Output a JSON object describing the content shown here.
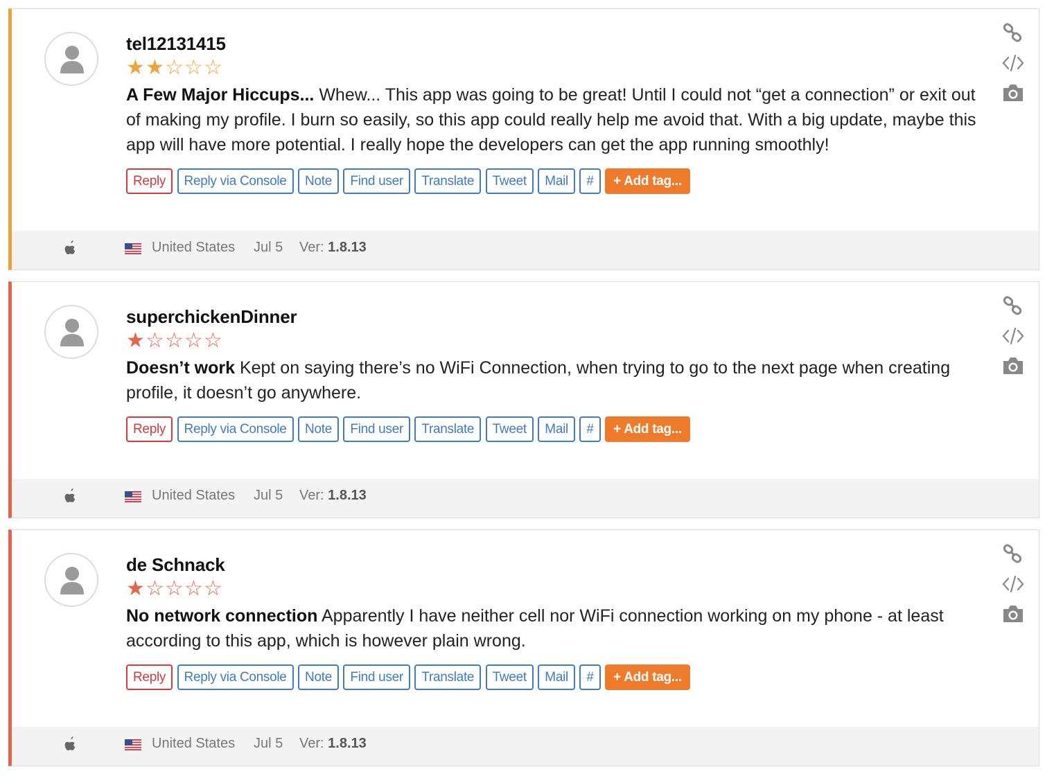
{
  "actions": {
    "reply": "Reply",
    "reply_console": "Reply via Console",
    "note": "Note",
    "find_user": "Find user",
    "translate": "Translate",
    "tweet": "Tweet",
    "mail": "Mail",
    "hash": "#",
    "add_tag": "+ Add tag..."
  },
  "footer_labels": {
    "ver_prefix": "Ver:"
  },
  "side_icons": [
    "link-icon",
    "code-icon",
    "camera-icon"
  ],
  "colors": {
    "orange": "#f0a33a",
    "red": "#e2654b",
    "link_blue": "#3f7bbf",
    "tag_orange": "#ee7b2c"
  },
  "reviews": [
    {
      "username": "tel12131415",
      "rating": 2,
      "stars": "★★☆☆☆",
      "title": "A Few Major Hiccups...",
      "body": "Whew... This app was going to be great! Until I could not “get a connection” or exit out of making my profile. I burn so easily, so this app could really help me avoid that. With a big update, maybe this app will have more potential. I really hope the developers can get the app running smoothly!",
      "platform": "apple-icon",
      "country": "United States",
      "date": "Jul 5",
      "version": "1.8.13"
    },
    {
      "username": "superchickenDinner",
      "rating": 1,
      "stars": "★☆☆☆☆",
      "title": "Doesn’t work",
      "body": "Kept on saying there’s no WiFi Connection, when trying to go to the next page when creating profile, it doesn’t go anywhere.",
      "platform": "apple-icon",
      "country": "United States",
      "date": "Jul 5",
      "version": "1.8.13"
    },
    {
      "username": "de Schnack",
      "rating": 1,
      "stars": "★☆☆☆☆",
      "title": "No network connection",
      "body": "Apparently I have neither cell nor WiFi connection working on my phone - at least according to this app, which is however plain wrong.",
      "platform": "apple-icon",
      "country": "United States",
      "date": "Jul 5",
      "version": "1.8.13"
    }
  ]
}
